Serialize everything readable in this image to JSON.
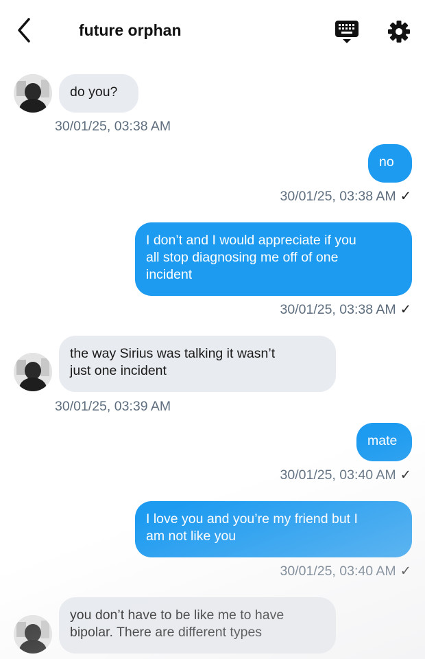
{
  "header": {
    "title": "future orphan"
  },
  "messages": [
    {
      "text": "do you?",
      "time": "30/01/25, 03:38 AM"
    },
    {
      "text": "no",
      "time": "30/01/25, 03:38 AM",
      "check": "✓"
    },
    {
      "text": "I don’t and I would appreciate if you\nall stop diagnosing me off of one\nincident",
      "time": "30/01/25, 03:38 AM",
      "check": "✓"
    },
    {
      "text": "the way Sirius was talking it wasn’t\njust one incident",
      "time": "30/01/25, 03:39 AM"
    },
    {
      "text": "mate",
      "time": "30/01/25, 03:40 AM",
      "check": "✓"
    },
    {
      "text": "I love you and you’re my friend but I\nam not like you",
      "time": "30/01/25, 03:40 AM",
      "check": "✓"
    },
    {
      "text": "you don’t have to be like me to have\nbipolar. There are different types"
    }
  ],
  "colors": {
    "outgoing_bubble": "#1d9bf0",
    "incoming_bubble": "#e8ebef",
    "timestamp": "#5e6e7e"
  },
  "icons": {
    "back": "chevron-left-icon",
    "keyboard": "keyboard-icon",
    "settings": "gear-icon",
    "read": "checkmark-icon"
  }
}
